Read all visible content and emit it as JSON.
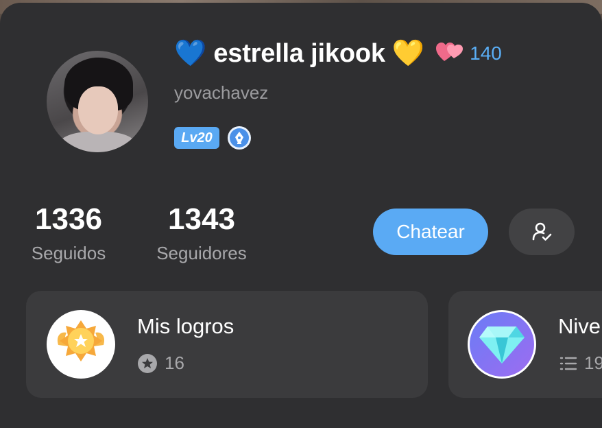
{
  "profile": {
    "name_emoji_left": "💙",
    "name": "estrella jikook",
    "name_emoji_right": "💛",
    "hearts_count": "140",
    "username": "yovachavez",
    "level": "Lv20"
  },
  "stats": {
    "following_count": "1336",
    "following_label": "Seguidos",
    "followers_count": "1343",
    "followers_label": "Seguidores"
  },
  "actions": {
    "chat_label": "Chatear",
    "follow_icon": "user-check-icon"
  },
  "tiles": {
    "achievements_title": "Mis logros",
    "achievements_count": "16",
    "level_title": "Nive",
    "level_count": "19"
  },
  "colors": {
    "accent": "#5aaaf4",
    "card_bg": "#2f2f31",
    "tile_bg": "#3b3b3d"
  }
}
